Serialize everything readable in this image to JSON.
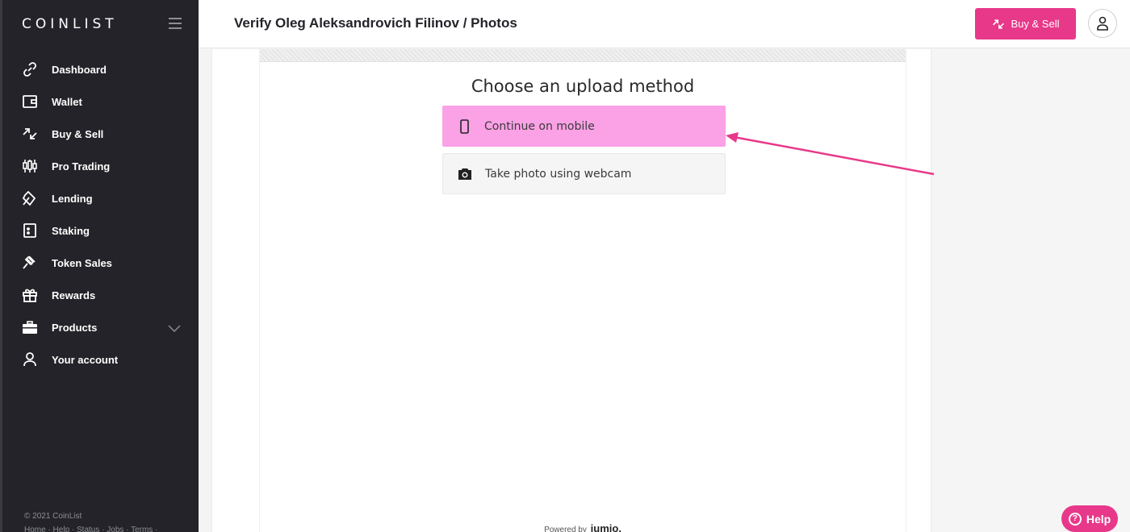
{
  "sidebar": {
    "logo": "COINLIST",
    "items": [
      {
        "label": "Dashboard",
        "icon": "link-icon"
      },
      {
        "label": "Wallet",
        "icon": "wallet-icon"
      },
      {
        "label": "Buy & Sell",
        "icon": "exchange-arrows-icon"
      },
      {
        "label": "Pro Trading",
        "icon": "candlestick-icon"
      },
      {
        "label": "Lending",
        "icon": "lending-icon"
      },
      {
        "label": "Staking",
        "icon": "staking-icon"
      },
      {
        "label": "Token Sales",
        "icon": "gavel-icon"
      },
      {
        "label": "Rewards",
        "icon": "gift-icon"
      },
      {
        "label": "Products",
        "icon": "briefcase-icon"
      },
      {
        "label": "Your account",
        "icon": "user-icon"
      }
    ],
    "footer_copyright": "© 2021 CoinList",
    "footer_links": "Home · Help · Status · Jobs · Terms ·"
  },
  "header": {
    "title": "Verify Oleg Aleksandrovich Filinov / Photos",
    "buy_sell_label": "Buy & Sell"
  },
  "upload": {
    "heading": "Choose an upload method",
    "option_mobile": "Continue on mobile",
    "option_webcam": "Take photo using webcam",
    "powered_by": "Powered by",
    "powered_brand": "jumio."
  },
  "help_label": "Help",
  "colors": {
    "accent": "#e8388a",
    "sidebar_bg": "#232329",
    "mobile_option_bg": "#fba1e6"
  }
}
